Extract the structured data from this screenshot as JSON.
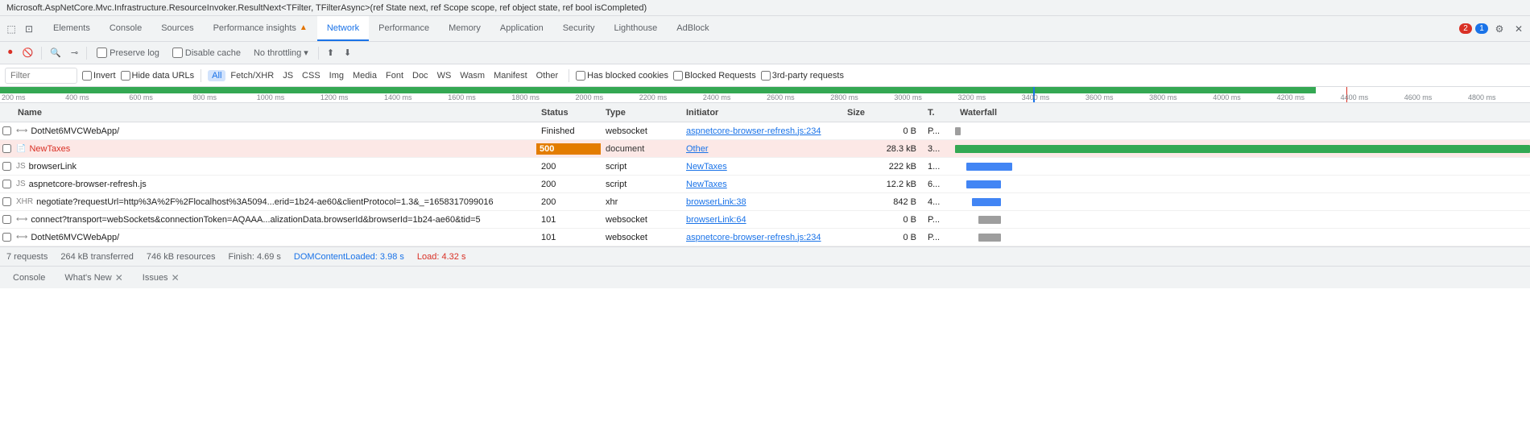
{
  "infoBar": {
    "text": "Microsoft.AspNetCore.Mvc.Infrastructure.ResourceInvoker.ResultNext<TFilter, TFilterAsync>(ref State next, ref Scope scope, ref object state, ref bool isCompleted)"
  },
  "tabs": [
    {
      "id": "elements",
      "label": "Elements",
      "active": false
    },
    {
      "id": "console",
      "label": "Console",
      "active": false
    },
    {
      "id": "sources",
      "label": "Sources",
      "active": false
    },
    {
      "id": "performance-insights",
      "label": "Performance insights",
      "active": false,
      "badge": "▲"
    },
    {
      "id": "network",
      "label": "Network",
      "active": true
    },
    {
      "id": "performance",
      "label": "Performance",
      "active": false
    },
    {
      "id": "memory",
      "label": "Memory",
      "active": false
    },
    {
      "id": "application",
      "label": "Application",
      "active": false
    },
    {
      "id": "security",
      "label": "Security",
      "active": false
    },
    {
      "id": "lighthouse",
      "label": "Lighthouse",
      "active": false
    },
    {
      "id": "adblock",
      "label": "AdBlock",
      "active": false
    }
  ],
  "tabRight": {
    "badge1": "2",
    "badge2": "1"
  },
  "toolbar": {
    "preserveLog": "Preserve log",
    "disableCache": "Disable cache",
    "noThrottling": "No throttling"
  },
  "filterBar": {
    "placeholder": "Filter",
    "invert": "Invert",
    "hideDataUrls": "Hide data URLs",
    "all": "All",
    "fetch": "Fetch/XHR",
    "js": "JS",
    "css": "CSS",
    "img": "Img",
    "media": "Media",
    "font": "Font",
    "doc": "Doc",
    "ws": "WS",
    "wasm": "Wasm",
    "manifest": "Manifest",
    "other": "Other",
    "hasBlockedCookies": "Has blocked cookies",
    "blockedRequests": "Blocked Requests",
    "thirdPartyRequests": "3rd-party requests"
  },
  "timeline": {
    "ticks": [
      "200 ms",
      "400 ms",
      "600 ms",
      "800 ms",
      "1000 ms",
      "1200 ms",
      "1400 ms",
      "1600 ms",
      "1800 ms",
      "2000 ms",
      "2200 ms",
      "2400 ms",
      "2600 ms",
      "2800 ms",
      "3000 ms",
      "3200 ms",
      "3400 ms",
      "3600 ms",
      "3800 ms",
      "4000 ms",
      "4200 ms",
      "4400 ms",
      "4600 ms",
      "4800 ms"
    ]
  },
  "columns": {
    "name": "Name",
    "status": "Status",
    "type": "Type",
    "initiator": "Initiator",
    "size": "Size",
    "time": "T.",
    "waterfall": "Waterfall"
  },
  "rows": [
    {
      "name": "DotNet6MVCWebApp/",
      "status": "Finished",
      "type": "websocket",
      "initiator": "aspnetcore-browser-refresh.js:234",
      "size": "0 B",
      "time": "P...",
      "isError": false,
      "waterfallOffset": 0,
      "waterfallWidth": 6,
      "waterfallColor": "gray"
    },
    {
      "name": "NewTaxes",
      "status": "500",
      "type": "document",
      "initiator": "Other",
      "size": "28.3 kB",
      "time": "3...",
      "isError": true,
      "waterfallOffset": 0,
      "waterfallWidth": 100,
      "waterfallColor": "green"
    },
    {
      "name": "browserLink",
      "status": "200",
      "type": "script",
      "initiator": "NewTaxes",
      "size": "222 kB",
      "time": "1...",
      "isError": false,
      "waterfallOffset": 5,
      "waterfallWidth": 12,
      "waterfallColor": "blue"
    },
    {
      "name": "aspnetcore-browser-refresh.js",
      "status": "200",
      "type": "script",
      "initiator": "NewTaxes",
      "size": "12.2 kB",
      "time": "6...",
      "isError": false,
      "waterfallOffset": 5,
      "waterfallWidth": 10,
      "waterfallColor": "blue"
    },
    {
      "name": "negotiate?requestUrl=http%3A%2F%2Flocalhost%3A5094...erid=1b24-ae60&clientProtocol=1.3&_=1658317099016",
      "status": "200",
      "type": "xhr",
      "initiator": "browserLink:38",
      "size": "842 B",
      "time": "4...",
      "isError": false,
      "waterfallOffset": 7,
      "waterfallWidth": 8,
      "waterfallColor": "blue"
    },
    {
      "name": "connect?transport=webSockets&connectionToken=AQAAA...alizationData.browserId&browserId=1b24-ae60&tid=5",
      "status": "101",
      "type": "websocket",
      "initiator": "browserLink:64",
      "size": "0 B",
      "time": "P...",
      "isError": false,
      "waterfallOffset": 9,
      "waterfallWidth": 5,
      "waterfallColor": "gray"
    },
    {
      "name": "DotNet6MVCWebApp/",
      "status": "101",
      "type": "websocket",
      "initiator": "aspnetcore-browser-refresh.js:234",
      "size": "0 B",
      "time": "P...",
      "isError": false,
      "waterfallOffset": 9,
      "waterfallWidth": 5,
      "waterfallColor": "gray"
    }
  ],
  "statusBar": {
    "requests": "7 requests",
    "transferred": "264 kB transferred",
    "resources": "746 kB resources",
    "finish": "Finish: 4.69 s",
    "domContentLoaded": "DOMContentLoaded: 3.98 s",
    "load": "Load: 4.32 s"
  },
  "bottomTabs": [
    {
      "label": "Console",
      "hasClose": false
    },
    {
      "label": "What's New",
      "hasClose": false
    },
    {
      "label": "Issues",
      "hasClose": false
    }
  ]
}
